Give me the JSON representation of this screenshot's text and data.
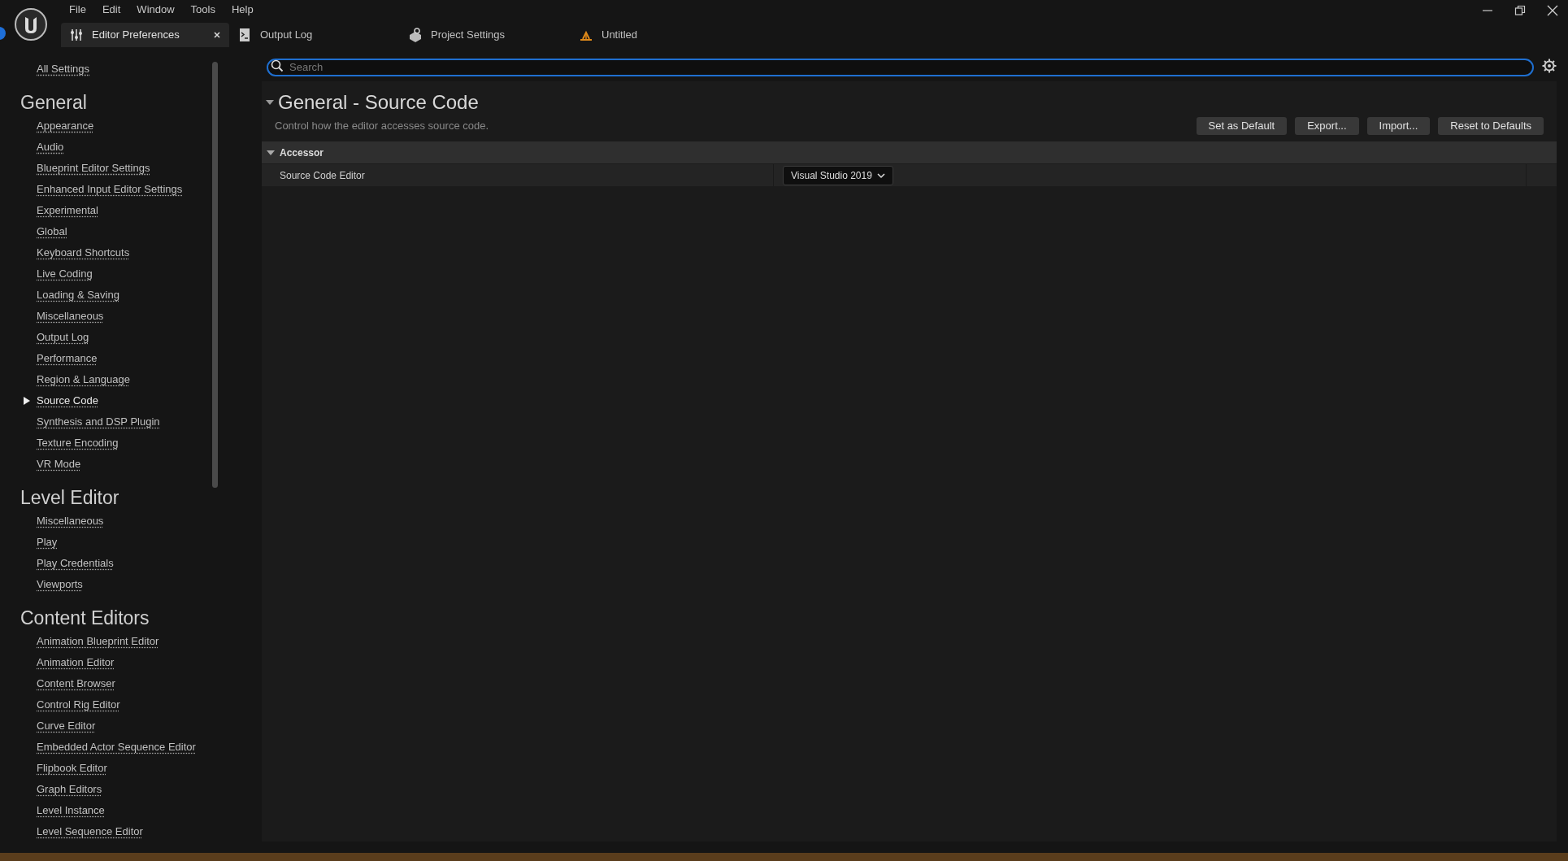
{
  "menu": [
    "File",
    "Edit",
    "Window",
    "Tools",
    "Help"
  ],
  "tabs": [
    {
      "label": "Editor Preferences",
      "kind": "preferences",
      "selected": true,
      "closable": true
    },
    {
      "label": "Output Log",
      "kind": "log",
      "selected": false,
      "closable": false
    },
    {
      "label": "Project Settings",
      "kind": "project",
      "selected": false,
      "closable": false
    },
    {
      "label": "Untitled",
      "kind": "level",
      "selected": false,
      "closable": false
    }
  ],
  "sidebar": {
    "all_settings": "All Settings",
    "groups": [
      {
        "title": "General",
        "items": [
          {
            "label": "Appearance",
            "selected": false
          },
          {
            "label": "Audio",
            "selected": false
          },
          {
            "label": "Blueprint Editor Settings",
            "selected": false
          },
          {
            "label": "Enhanced Input Editor Settings",
            "selected": false
          },
          {
            "label": "Experimental",
            "selected": false
          },
          {
            "label": "Global",
            "selected": false
          },
          {
            "label": "Keyboard Shortcuts",
            "selected": false
          },
          {
            "label": "Live Coding",
            "selected": false
          },
          {
            "label": "Loading & Saving",
            "selected": false
          },
          {
            "label": "Miscellaneous",
            "selected": false
          },
          {
            "label": "Output Log",
            "selected": false
          },
          {
            "label": "Performance",
            "selected": false
          },
          {
            "label": "Region & Language",
            "selected": false
          },
          {
            "label": "Source Code",
            "selected": true
          },
          {
            "label": "Synthesis and DSP Plugin",
            "selected": false
          },
          {
            "label": "Texture Encoding",
            "selected": false
          },
          {
            "label": "VR Mode",
            "selected": false
          }
        ]
      },
      {
        "title": "Level Editor",
        "items": [
          {
            "label": "Miscellaneous",
            "selected": false
          },
          {
            "label": "Play",
            "selected": false
          },
          {
            "label": "Play Credentials",
            "selected": false
          },
          {
            "label": "Viewports",
            "selected": false
          }
        ]
      },
      {
        "title": "Content Editors",
        "items": [
          {
            "label": "Animation Blueprint Editor",
            "selected": false
          },
          {
            "label": "Animation Editor",
            "selected": false
          },
          {
            "label": "Content Browser",
            "selected": false
          },
          {
            "label": "Control Rig Editor",
            "selected": false
          },
          {
            "label": "Curve Editor",
            "selected": false
          },
          {
            "label": "Embedded Actor Sequence Editor",
            "selected": false
          },
          {
            "label": "Flipbook Editor",
            "selected": false
          },
          {
            "label": "Graph Editors",
            "selected": false
          },
          {
            "label": "Level Instance",
            "selected": false
          },
          {
            "label": "Level Sequence Editor",
            "selected": false
          }
        ]
      }
    ]
  },
  "search": {
    "placeholder": "Search"
  },
  "section": {
    "title": "General - Source Code",
    "description": "Control how the editor accesses source code.",
    "expanded": true
  },
  "buttons": [
    "Set as Default",
    "Export...",
    "Import...",
    "Reset to Defaults"
  ],
  "category": {
    "title": "Accessor",
    "expanded": true,
    "properties": [
      {
        "name": "Source Code Editor",
        "value": "Visual Studio 2019"
      }
    ]
  }
}
